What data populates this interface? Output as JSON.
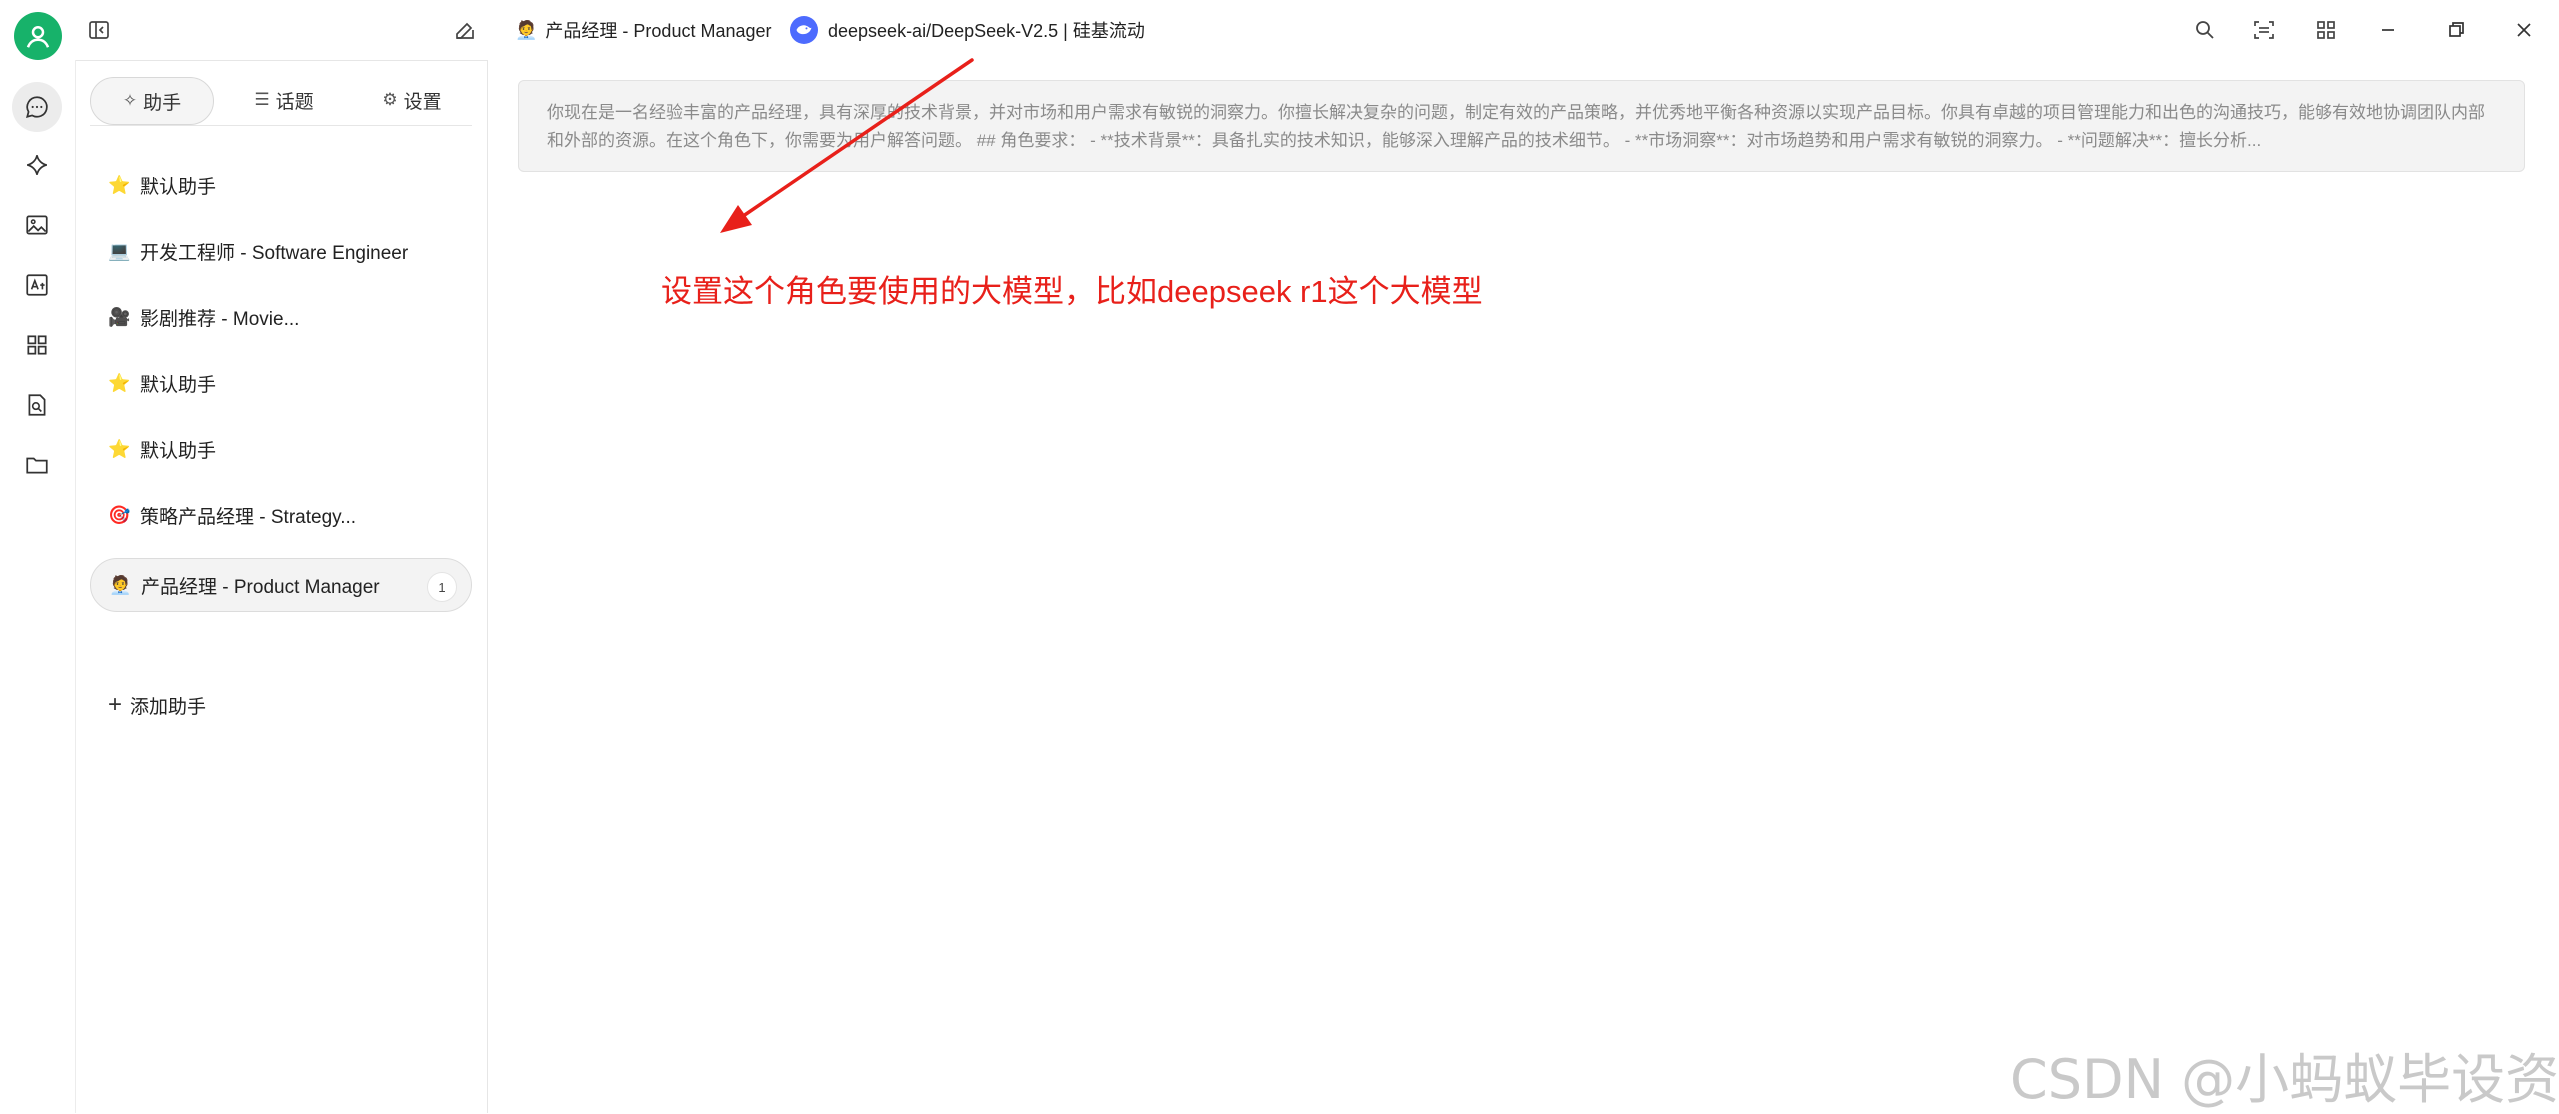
{
  "header": {
    "active_assistant_emoji": "🧑‍💼",
    "active_assistant_title": "产品经理 - Product Manager",
    "model_label": "deepseek-ai/DeepSeek-V2.5 | 硅基流动"
  },
  "sidebar": {
    "tabs": [
      {
        "label": "助手",
        "icon": "sparkle-icon",
        "active": true
      },
      {
        "label": "话题",
        "icon": "list-icon"
      },
      {
        "label": "设置",
        "icon": "gear-icon"
      }
    ],
    "items": [
      {
        "emoji": "⭐",
        "label": "默认助手"
      },
      {
        "emoji": "💻",
        "label": "开发工程师 - Software Engineer"
      },
      {
        "emoji": "🎥",
        "label": "影剧推荐 - Movie..."
      },
      {
        "emoji": "⭐",
        "label": "默认助手"
      },
      {
        "emoji": "⭐",
        "label": "默认助手"
      },
      {
        "emoji": "🎯",
        "label": "策略产品经理 - Strategy..."
      },
      {
        "emoji": "🧑‍💼",
        "label": "产品经理 - Product Manager",
        "badge": "1",
        "active": true
      }
    ],
    "add_label": "添加助手"
  },
  "main": {
    "system_prompt": "你现在是一名经验丰富的产品经理，具有深厚的技术背景，并对市场和用户需求有敏锐的洞察力。你擅长解决复杂的问题，制定有效的产品策略，并优秀地平衡各种资源以实现产品目标。你具有卓越的项目管理能力和出色的沟通技巧，能够有效地协调团队内部和外部的资源。在这个角色下，你需要为用户解答问题。 ## 角色要求： - **技术背景**：具备扎实的技术知识，能够深入理解产品的技术细节。 - **市场洞察**：对市场趋势和用户需求有敏锐的洞察力。 - **问题解决**：擅长分析..."
  },
  "annotation": {
    "text": "设置这个角色要使用的大模型，比如deepseek  r1这个大模型",
    "color": "#e8201a"
  },
  "watermark": "CSDN @小蚂蚁毕设资源",
  "colors": {
    "accent": "#17b26a",
    "model_logo": "#4d6bfe",
    "annotation": "#e8201a"
  }
}
